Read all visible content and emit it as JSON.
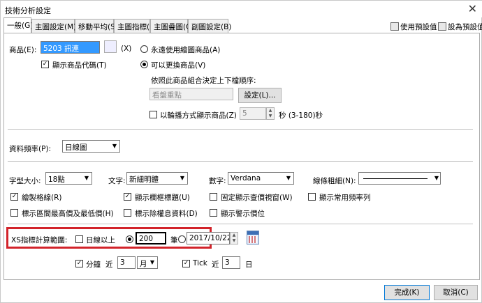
{
  "window": {
    "title": "技術分析設定",
    "close_glyph": "✕"
  },
  "tabs": [
    {
      "label": "一般(G)"
    },
    {
      "label": "主圖設定(M)"
    },
    {
      "label": "移動平均(S)"
    },
    {
      "label": "主圖指標(I)"
    },
    {
      "label": "主圖疊圖(O)"
    },
    {
      "label": "副圖設定(B)"
    }
  ],
  "header_buttons": {
    "use_default": "使用預設值",
    "set_default": "設為預設值"
  },
  "product": {
    "label": "商品(E):",
    "value": "5203 訊連",
    "clear_label": "(X)",
    "show_code_label": "顯示商品代碼(T)",
    "always_original_label": "永遠使用繪圖商品(A)",
    "changeable_label": "可以更換商品(V)",
    "order_hint": "依照此商品組合決定上下檔順序:",
    "group_value": "看盤重點",
    "setup_button": "設定(L)...",
    "rotate_label": "以輪播方式顯示商品(Z)",
    "rotate_seconds": "5",
    "rotate_unit": "秒 (3-180)秒"
  },
  "frequency": {
    "label": "資料頻率(P):",
    "value": "日線圖"
  },
  "fonts": {
    "size_label": "字型大小:",
    "size_value": "18點",
    "text_label": "文字:",
    "text_value": "新細明體",
    "number_label": "數字:",
    "number_value": "Verdana",
    "line_label": "線條粗細(N):"
  },
  "options": {
    "draw_grid": "繪製格線(R)",
    "show_grid_title": "顯示欄框標題(U)",
    "fixed_price_window": "固定顯示查價視窗(W)",
    "show_common_freq": "顯示常用頻率列",
    "mark_high_low": "標示區間最高價及最低價(H)",
    "mark_ex_rights": "標示除權息資料(D)",
    "show_alert_price": "顯示警示價位"
  },
  "xs": {
    "range_label": "XS指標計算範圍:",
    "daily_above_label": "日線以上",
    "bars_value": "200",
    "bars_unit": "筆",
    "date_value": "2017/10/22",
    "minute_label": "分鐘",
    "minute_near": "近",
    "minute_value": "3",
    "minute_unit": "月",
    "tick_label": "Tick",
    "tick_near": "近",
    "tick_value": "3",
    "tick_unit": "日"
  },
  "footer": {
    "ok": "完成(K)",
    "cancel": "取消(C)"
  },
  "colors": {
    "highlight": "#d2232a",
    "selection": "#3399ff"
  }
}
